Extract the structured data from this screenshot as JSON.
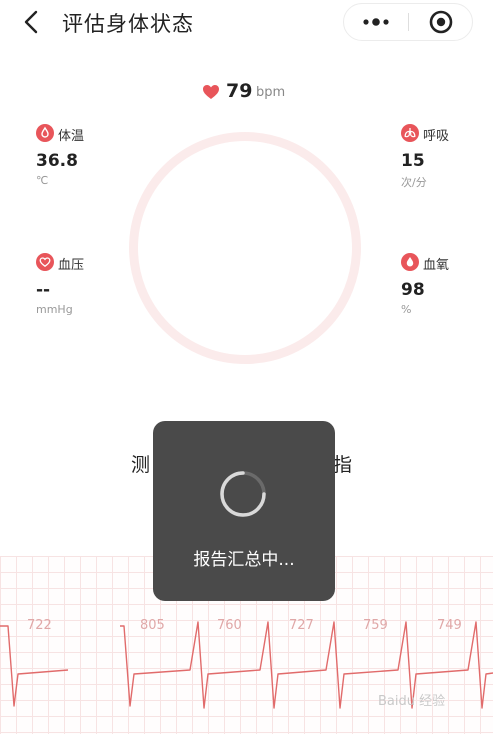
{
  "header": {
    "title": "评估身体状态"
  },
  "heart_rate": {
    "value": "79",
    "unit": "bpm"
  },
  "vitals": {
    "temperature": {
      "label": "体温",
      "value": "36.8",
      "unit": "℃"
    },
    "respiration": {
      "label": "呼吸",
      "value": "15",
      "unit": "次/分"
    },
    "blood_pressure": {
      "label": "血压",
      "value": "--",
      "unit": "mmHg"
    },
    "blood_oxygen": {
      "label": "血氧",
      "value": "98",
      "unit": "%"
    }
  },
  "measure_hint": {
    "left": "测",
    "right": "指"
  },
  "ecg": {
    "rr_intervals": [
      "722",
      "805",
      "760",
      "727",
      "759",
      "749"
    ]
  },
  "toast": {
    "text": "报告汇总中..."
  },
  "watermark": {
    "text": "Baidu 经验"
  },
  "colors": {
    "accent": "#e8555a",
    "ring": "#fbebeb",
    "ecg_line": "#e16b6b",
    "toast_bg": "#4a4a4a"
  },
  "icons": {
    "back": "chevron-left-icon",
    "more": "more-dots-icon",
    "close": "target-circle-icon",
    "heart": "heart-icon",
    "temperature": "thermometer-drop-icon",
    "respiration": "lungs-icon",
    "blood_pressure": "heart-outline-icon",
    "blood_oxygen": "drop-icon"
  }
}
